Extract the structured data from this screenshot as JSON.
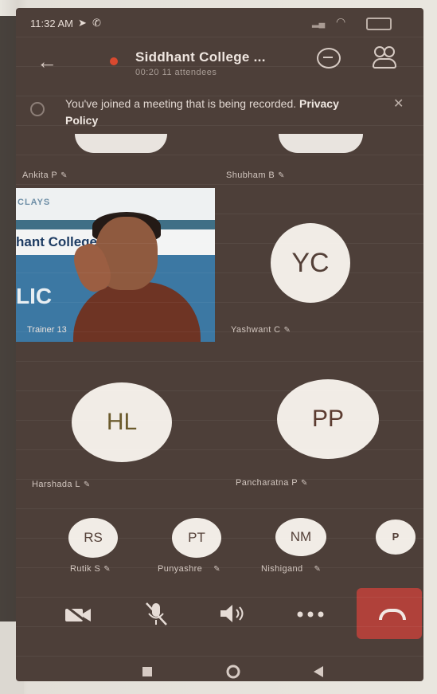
{
  "status_bar": {
    "time": "11:32 AM"
  },
  "meeting": {
    "title": "Siddhant College ...",
    "subtitle": "00:20  11 attendees"
  },
  "banner": {
    "text": "You've joined a meeting that is being recorded.",
    "link": "Privacy Policy"
  },
  "participants_top": [
    {
      "name": "Ankita P"
    },
    {
      "name": "Shubham B"
    }
  ],
  "video_tile": {
    "label": "Trainer 13",
    "slide_brand": "CLAYS",
    "slide_title": "hant College of Phar",
    "slide_fragment": "LIC"
  },
  "tiles": [
    {
      "initials": "YC",
      "name": "Yashwant C"
    },
    {
      "initials": "HL",
      "name": "Harshada L"
    },
    {
      "initials": "PP",
      "name": "Pancharatna P"
    }
  ],
  "small_tiles": [
    {
      "initials": "RS",
      "name": "Rutik S"
    },
    {
      "initials": "PT",
      "name": "Punyashre"
    },
    {
      "initials": "NM",
      "name": "Nishigand"
    },
    {
      "initials": "P",
      "name": ""
    }
  ],
  "colors": {
    "background": "#4d3f39",
    "avatar": "#f1ece6",
    "end_call": "#b0413a",
    "recording": "#d9492f"
  }
}
